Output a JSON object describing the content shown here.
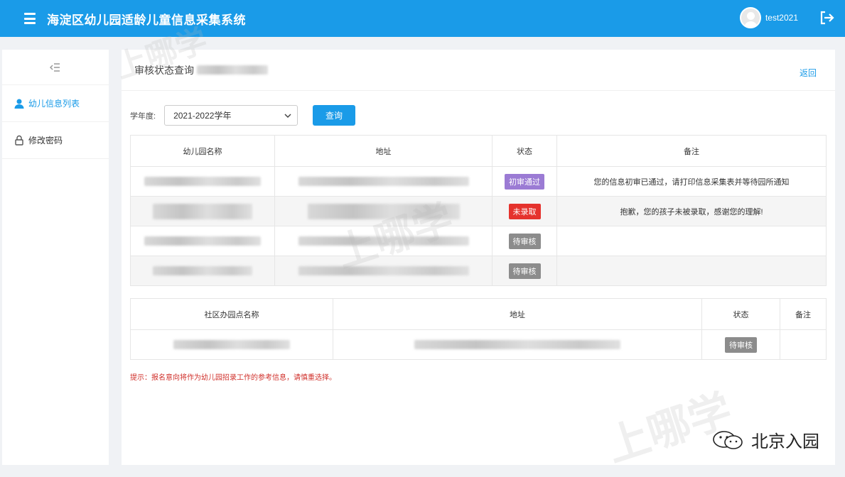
{
  "header": {
    "title": "海淀区幼儿园适龄儿童信息采集系统",
    "username": "test2021"
  },
  "sidebar": {
    "items": [
      {
        "label": "幼儿信息列表",
        "icon": "user-icon",
        "active": true
      },
      {
        "label": "修改密码",
        "icon": "lock-icon",
        "active": false
      }
    ]
  },
  "main": {
    "title": "审核状态查询",
    "back_label": "返回",
    "filter": {
      "label": "学年度:",
      "selected": "2021-2022学年",
      "query_label": "查询"
    },
    "table1": {
      "headers": [
        "幼儿园名称",
        "地址",
        "状态",
        "备注"
      ],
      "rows": [
        {
          "status": "初审通过",
          "status_color": "#9b7bd4",
          "remark": "您的信息初审已通过，请打印信息采集表并等待园所通知"
        },
        {
          "status": "未录取",
          "status_color": "#e5322d",
          "remark": "抱歉，您的孩子未被录取，感谢您的理解!"
        },
        {
          "status": "待审核",
          "status_color": "#8c8c8c",
          "remark": ""
        },
        {
          "status": "待审核",
          "status_color": "#8c8c8c",
          "remark": ""
        }
      ]
    },
    "table2": {
      "headers": [
        "社区办园点名称",
        "地址",
        "状态",
        "备注"
      ],
      "rows": [
        {
          "status": "待审核",
          "status_color": "#8c8c8c",
          "remark": ""
        }
      ]
    },
    "hint": "提示：报名意向将作为幼儿园招录工作的参考信息，请慎重选择。"
  },
  "watermark": {
    "text": "上哪学",
    "brand": "北京入园"
  },
  "colors": {
    "primary": "#1a9be8",
    "hint_red": "#d0302b"
  }
}
